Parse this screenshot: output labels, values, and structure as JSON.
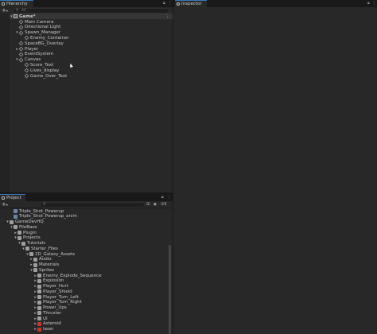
{
  "hierarchy": {
    "tab_label": "Hierarchy",
    "add_label": "+",
    "add_dropdown": "▾",
    "search_placeholder": "All",
    "scene_name": "Game*",
    "items": [
      {
        "label": "Main Camera",
        "icon": "gameobject-icon"
      },
      {
        "label": "Directional Light",
        "icon": "gameobject-icon"
      },
      {
        "label": "Spawn_Manager",
        "icon": "gameobject-icon",
        "expanded": true
      },
      {
        "label": "Enemy_Container",
        "icon": "gameobject-icon"
      },
      {
        "label": "SpaceBG_Overlay",
        "icon": "gameobject-icon"
      },
      {
        "label": "Player",
        "icon": "gameobject-icon",
        "collapsed": true
      },
      {
        "label": "EventSystem",
        "icon": "gameobject-icon"
      },
      {
        "label": "Canvas",
        "icon": "gameobject-icon",
        "expanded": true
      },
      {
        "label": "Score_Text",
        "icon": "gameobject-icon"
      },
      {
        "label": "Lives_display",
        "icon": "gameobject-icon"
      },
      {
        "label": "Game_Over_Text",
        "icon": "gameobject-icon"
      }
    ]
  },
  "inspector": {
    "tab_label": "Inspector"
  },
  "project": {
    "tab_label": "Project",
    "add_label": "+",
    "add_dropdown": "▾",
    "hidden_count": "9",
    "items": [
      {
        "label": "Triple_Shot_Powerup",
        "icon": "asset-icon"
      },
      {
        "label": "Triple_Shot_Powerup_anim",
        "icon": "asset-icon"
      },
      {
        "label": "GameDevHQ",
        "icon": "folder-icon"
      },
      {
        "label": "FileBase",
        "icon": "folder-icon"
      },
      {
        "label": "Plugin",
        "icon": "folder-icon"
      },
      {
        "label": "Projects",
        "icon": "folder-icon"
      },
      {
        "label": "Tutorials",
        "icon": "folder-icon"
      },
      {
        "label": "Starter_Files",
        "icon": "folder-icon"
      },
      {
        "label": "2D_Galaxy_Assets",
        "icon": "folder-icon"
      },
      {
        "label": "Audio",
        "icon": "folder-icon"
      },
      {
        "label": "Materials",
        "icon": "folder-icon"
      },
      {
        "label": "Sprites",
        "icon": "folder-icon"
      },
      {
        "label": "Enemy_Explode_Sequence",
        "icon": "folder-icon"
      },
      {
        "label": "Explosion",
        "icon": "folder-icon"
      },
      {
        "label": "Player_Hurt",
        "icon": "folder-icon"
      },
      {
        "label": "Player_Shield",
        "icon": "folder-icon"
      },
      {
        "label": "Player_Turn_Left",
        "icon": "folder-icon"
      },
      {
        "label": "Player_Turn_Right",
        "icon": "folder-icon"
      },
      {
        "label": "Power_Ups",
        "icon": "folder-icon"
      },
      {
        "label": "Thruster",
        "icon": "folder-icon"
      },
      {
        "label": "UI",
        "icon": "folder-icon"
      },
      {
        "label": "Asteroid",
        "icon": "sprite-icon"
      },
      {
        "label": "laser",
        "icon": "sprite-icon"
      }
    ]
  }
}
